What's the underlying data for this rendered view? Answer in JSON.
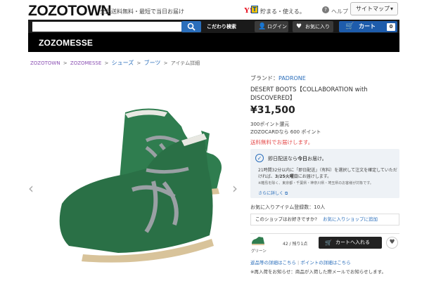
{
  "header": {
    "logo": "ZOZOTOWN",
    "tagline": "全品送料無料・最短で当日お届け",
    "yahoo": "Y!",
    "tpoint": "T",
    "earn": "貯まる・使える。",
    "help": "ヘルプ",
    "sitemap": "サイトマップ"
  },
  "nav": {
    "search_placeholder": "",
    "advanced_search": "こだわり検索",
    "login": "ログイン",
    "favorites": "お気に入り",
    "cart": "カート",
    "cart_count": "0"
  },
  "shop": {
    "name": "ZOZOMESSE"
  },
  "breadcrumb": {
    "items": [
      "ZOZOTOWN",
      "ZOZOMESSE",
      "シューズ",
      "ブーツ",
      "アイテム詳細"
    ],
    "separator": ">"
  },
  "product": {
    "brand_label": "ブランド：",
    "brand": "PADRONE",
    "title": "DESERT BOOTS【COLLABORATION with DISCOVERED】",
    "price": "¥31,500",
    "points_line1": "300ポイント還元",
    "points_line2": "ZOZOCARDなら 600 ポイント",
    "shipping": "送料無料でお届けします。",
    "image_prev": "‹",
    "image_next": "›"
  },
  "delivery": {
    "header_prefix": "即日配送なら",
    "header_bold": "今日",
    "header_suffix": "お届け。",
    "body_1": "21時間32分以内に「即日配送」（有料）を選択して注文を確定していただければ、",
    "body_bold": "3/25火曜日",
    "body_2": "にお届けします。",
    "note": "※離島を除く、東京都・千葉県・神奈川県・埼玉県のお客様が対象です。",
    "more": "さらに詳しく"
  },
  "favorites": {
    "count_text": "お気に入りアイテム登録数：10人"
  },
  "shop_fav": {
    "question": "このショップはお好きですか?",
    "link": "お気に入りショップに追加"
  },
  "sku": {
    "color": "グリーン",
    "stock": "42 / 残り1点",
    "add_to_cart": "カートへ入れる"
  },
  "footer_links": {
    "return": "返品等の詳細はこちら",
    "points": "ポイントの詳細はこちら",
    "restock": "※再入荷をお知らせ：商品が入荷した際メールでお知らせします。"
  },
  "colors": {
    "accent_blue": "#2a6ebb",
    "cart_blue": "#1e5cab",
    "price_red": "#e44b4b",
    "shoe_green": "#2f7d4f"
  }
}
